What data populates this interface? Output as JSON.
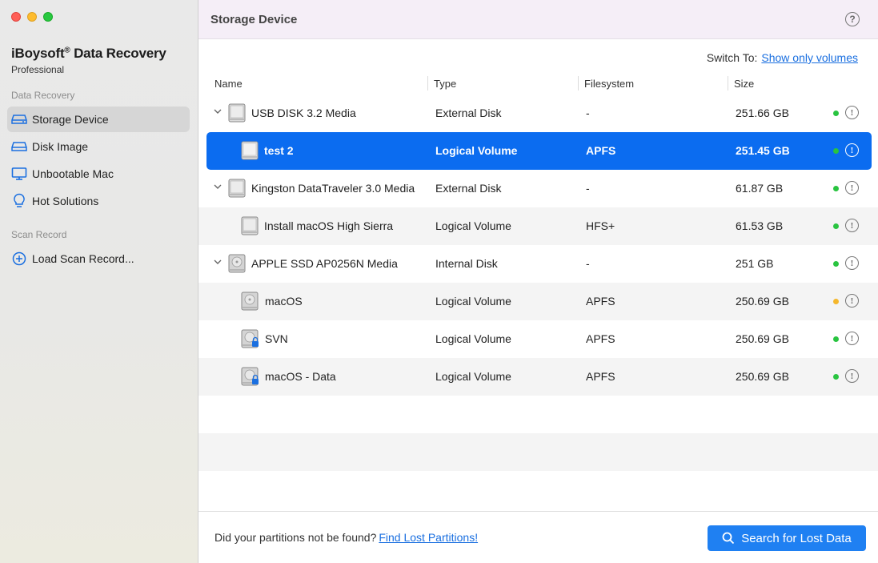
{
  "sidebar": {
    "app_name": "iBoysoft",
    "app_name_mark": "®",
    "app_name_rest": " Data Recovery",
    "edition": "Professional",
    "section_recovery": "Data Recovery",
    "section_scan": "Scan Record",
    "items": [
      {
        "label": "Storage Device",
        "icon": "storage-device-icon"
      },
      {
        "label": "Disk Image",
        "icon": "disk-image-icon"
      },
      {
        "label": "Unbootable Mac",
        "icon": "monitor-icon"
      },
      {
        "label": "Hot Solutions",
        "icon": "lightbulb-icon"
      },
      {
        "label": "Load Scan Record...",
        "icon": "plus-circle-icon"
      }
    ]
  },
  "header": {
    "title": "Storage Device",
    "help": "?"
  },
  "switch": {
    "label": "Switch To:",
    "link": "Show only volumes"
  },
  "table": {
    "columns": [
      "Name",
      "Type",
      "Filesystem",
      "Size"
    ],
    "rows": [
      {
        "name": "USB DISK 3.2 Media",
        "type": "External Disk",
        "fs": "-",
        "size": "251.66 GB",
        "status": "#29c440"
      },
      {
        "name": "test 2",
        "type": "Logical Volume",
        "fs": "APFS",
        "size": "251.45 GB",
        "status": "#29c440"
      },
      {
        "name": "Kingston DataTraveler 3.0 Media",
        "type": "External Disk",
        "fs": "-",
        "size": "61.87 GB",
        "status": "#29c440"
      },
      {
        "name": "Install macOS High Sierra",
        "type": "Logical Volume",
        "fs": "HFS+",
        "size": "61.53 GB",
        "status": "#29c440"
      },
      {
        "name": "APPLE SSD AP0256N Media",
        "type": "Internal Disk",
        "fs": "-",
        "size": "251 GB",
        "status": "#29c440"
      },
      {
        "name": "macOS",
        "type": "Logical Volume",
        "fs": "APFS",
        "size": "250.69 GB",
        "status": "#f5b72b"
      },
      {
        "name": "SVN",
        "type": "Logical Volume",
        "fs": "APFS",
        "size": "250.69 GB",
        "status": "#29c440"
      },
      {
        "name": "macOS - Data",
        "type": "Logical Volume",
        "fs": "APFS",
        "size": "250.69 GB",
        "status": "#29c440"
      }
    ],
    "info_glyph": "!"
  },
  "footer": {
    "message": "Did your partitions not be found?",
    "link": "Find Lost Partitions!",
    "button": "Search for Lost Data"
  }
}
